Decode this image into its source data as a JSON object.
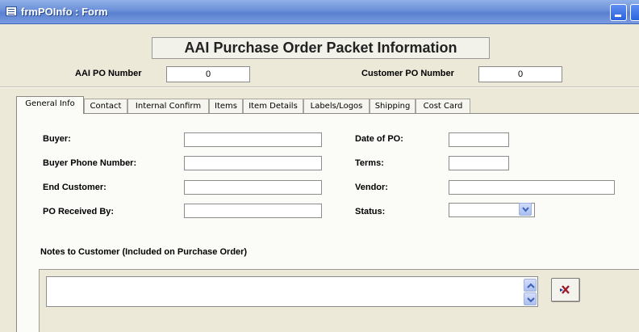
{
  "window": {
    "title": "frmPOInfo : Form"
  },
  "header": {
    "title": "AAI Purchase Order Packet Information",
    "aai_po_label": "AAI PO Number",
    "aai_po_value": "0",
    "customer_po_label": "Customer PO Number",
    "customer_po_value": "0"
  },
  "tabs": [
    {
      "label": "General Info"
    },
    {
      "label": "Contact"
    },
    {
      "label": "Internal Confirm"
    },
    {
      "label": "Items"
    },
    {
      "label": "Item Details"
    },
    {
      "label": "Labels/Logos"
    },
    {
      "label": "Shipping"
    },
    {
      "label": "Cost Card"
    }
  ],
  "active_tab": "General Info",
  "general": {
    "buyer_label": "Buyer:",
    "buyer_phone_label": "Buyer Phone Number:",
    "end_customer_label": "End Customer:",
    "po_received_by_label": "PO Received By:",
    "date_of_po_label": "Date of PO:",
    "terms_label": "Terms:",
    "vendor_label": "Vendor:",
    "status_label": "Status:"
  },
  "notes": {
    "label": "Notes to Customer (Included on Purchase Order)"
  },
  "icons": {
    "form_icon": "form-icon",
    "minimize": "minimize-icon",
    "dropdown": "chevron-down-icon",
    "scroll_up": "chevron-up-icon",
    "scroll_down": "chevron-down-icon",
    "clear": "delete-record-icon"
  },
  "colors": {
    "titlebar": "#6b8fd8",
    "form_background": "#ece9d8",
    "panel_background": "#fbfbf8",
    "clear_icon": "#a0182a"
  }
}
